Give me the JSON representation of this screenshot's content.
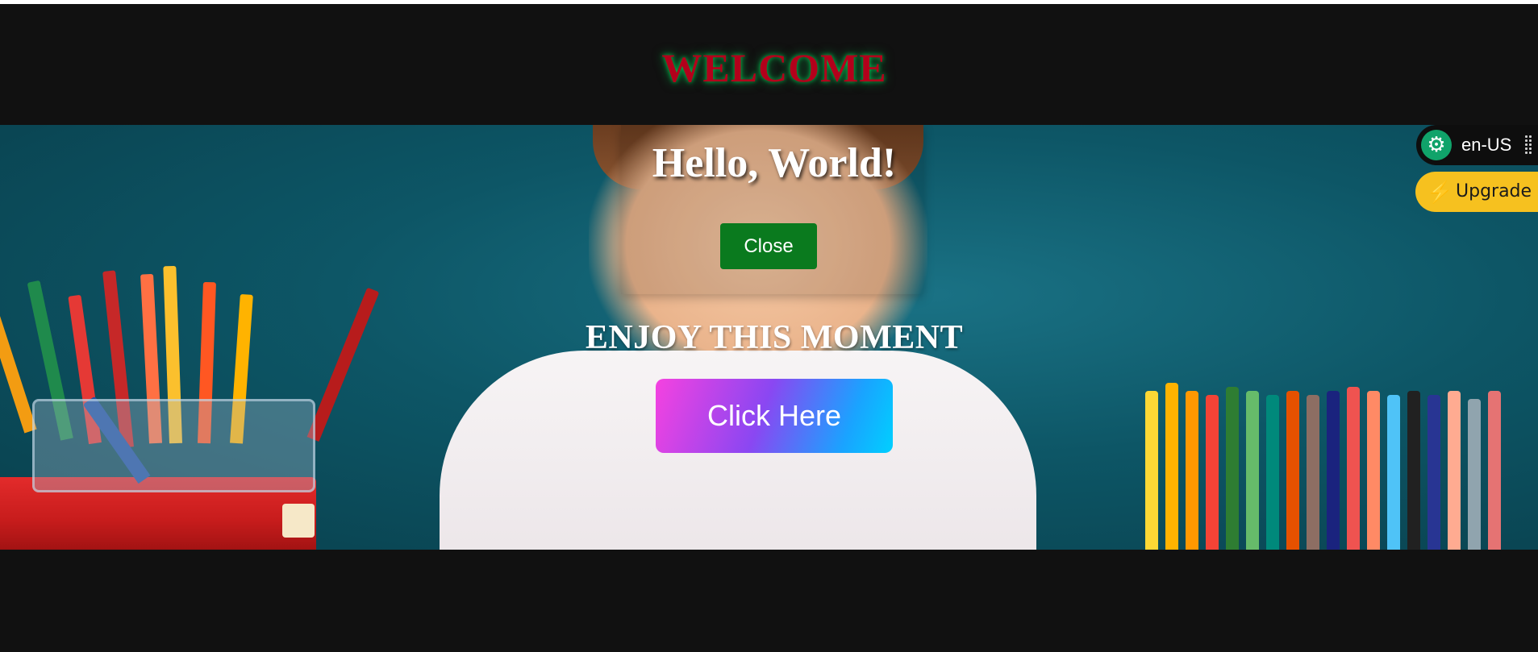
{
  "header": {
    "title": "WELCOME"
  },
  "hero": {
    "dialog_heading": "Hello, World!",
    "close_label": "Close",
    "tagline": "ENJOY THIS MOMENT",
    "cta_label": "Click Here"
  },
  "extension": {
    "language": "en-US",
    "upgrade_label": "Upgrade",
    "gear_icon": "gear-icon",
    "bolt_icon": "lightning-icon"
  },
  "colors": {
    "welcome_text": "#b3001b",
    "close_button": "#0a7a1e",
    "upgrade_pill": "#f6c11f",
    "cta_gradient_start": "#f542e0",
    "cta_gradient_end": "#00d0ff"
  }
}
